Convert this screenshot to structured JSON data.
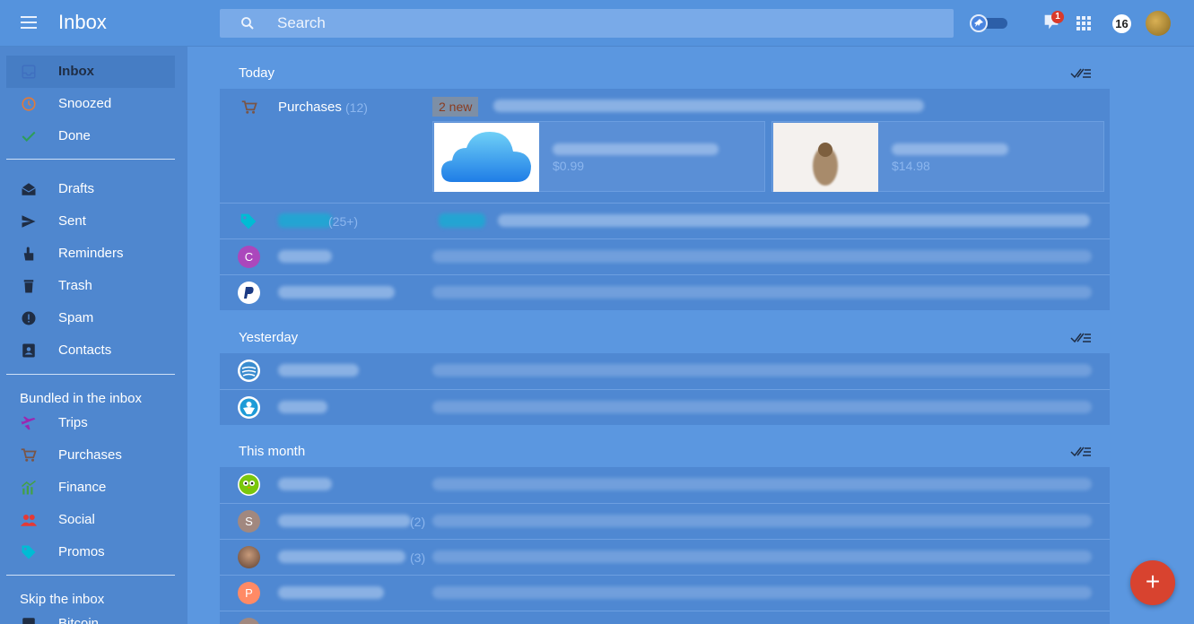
{
  "header": {
    "title": "Inbox",
    "search_placeholder": "Search",
    "notification_count": "1",
    "account_count": "16"
  },
  "sidebar": {
    "primary": [
      {
        "label": "Inbox",
        "icon": "inbox-icon",
        "active": true
      },
      {
        "label": "Snoozed",
        "icon": "clock-icon"
      },
      {
        "label": "Done",
        "icon": "check-icon"
      }
    ],
    "secondary": [
      {
        "label": "Drafts",
        "icon": "drafts-icon"
      },
      {
        "label": "Sent",
        "icon": "send-icon"
      },
      {
        "label": "Reminders",
        "icon": "reminder-icon"
      },
      {
        "label": "Trash",
        "icon": "trash-icon"
      },
      {
        "label": "Spam",
        "icon": "spam-icon"
      },
      {
        "label": "Contacts",
        "icon": "contacts-icon"
      }
    ],
    "bundled_heading": "Bundled in the inbox",
    "bundled": [
      {
        "label": "Trips",
        "icon": "plane-icon",
        "color": "#9c27b0"
      },
      {
        "label": "Purchases",
        "icon": "cart-icon",
        "color": "#795548"
      },
      {
        "label": "Finance",
        "icon": "finance-icon",
        "color": "#43a047"
      },
      {
        "label": "Social",
        "icon": "people-icon",
        "color": "#e53935"
      },
      {
        "label": "Promos",
        "icon": "tag-icon",
        "color": "#00bcd4"
      }
    ],
    "skip_heading": "Skip the inbox",
    "skip": [
      {
        "label": "Bitcoin",
        "icon": "label-icon"
      }
    ]
  },
  "groups": {
    "today": {
      "title": "Today",
      "purchases": {
        "name": "Purchases",
        "count": "(12)",
        "new_label": "2 new",
        "tiles": [
          {
            "price": "$0.99",
            "thumb": "icloud-icon"
          },
          {
            "price": "$14.98",
            "thumb": "itunes-thumb"
          }
        ]
      },
      "promos": {
        "count": "(25+)"
      }
    },
    "yesterday": {
      "title": "Yesterday"
    },
    "this_month": {
      "title": "This month",
      "avatars": [
        "S",
        "P"
      ],
      "counts": [
        "(2)",
        "(3)"
      ]
    }
  },
  "colors": {
    "accent": "#5593dd",
    "fab": "#d8432f",
    "promos": "#00bcd4"
  }
}
